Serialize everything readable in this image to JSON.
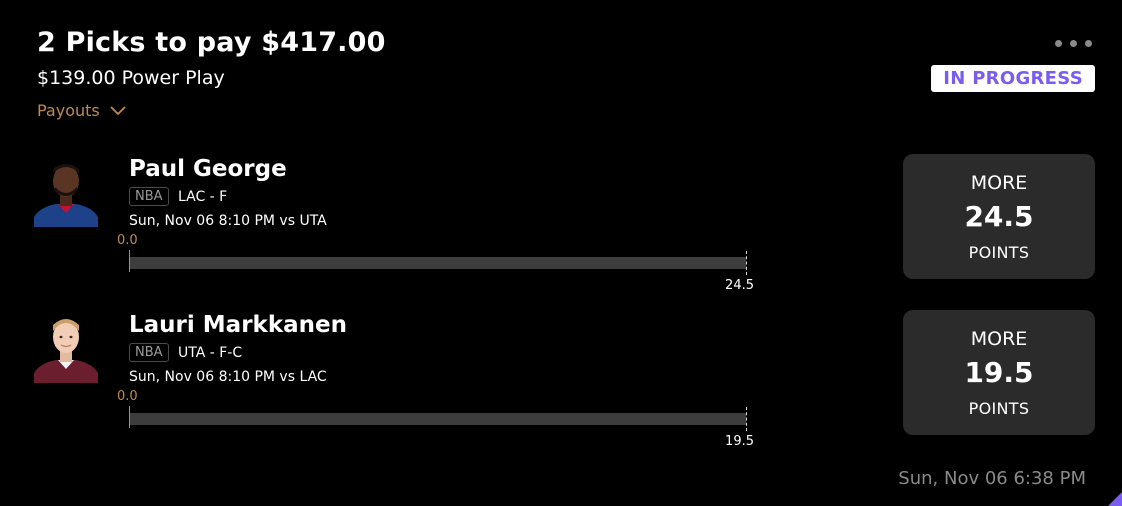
{
  "colors": {
    "background": "#000000",
    "accent_purple": "#7b5cf0",
    "muted_orange": "#c08a4e",
    "muted_text": "#8a8a8a",
    "card_bg": "#2b2b2b",
    "bar_track": "#3d3d3d"
  },
  "header": {
    "title": "2 Picks to pay $417.00",
    "subtitle": "$139.00 Power Play",
    "payouts_label": "Payouts",
    "payouts_icon": "chevron-down-icon",
    "menu_icon": "more-horizontal-icon",
    "status_label": "IN PROGRESS"
  },
  "picks": [
    {
      "player_name": "Paul George",
      "league": "NBA",
      "team_position": "LAC - F",
      "game_time": "Sun, Nov 06 8:10 PM  vs UTA",
      "current_value": "0.0",
      "target_value": "24.5",
      "progress": 0,
      "direction": "MORE",
      "line": "24.5",
      "stat": "POINTS",
      "jersey_color": "#1d428a"
    },
    {
      "player_name": "Lauri Markkanen",
      "league": "NBA",
      "team_position": "UTA - F-C",
      "game_time": "Sun, Nov 06 8:10 PM  vs LAC",
      "current_value": "0.0",
      "target_value": "19.5",
      "progress": 0,
      "direction": "MORE",
      "line": "19.5",
      "stat": "POINTS",
      "jersey_color": "#6b1f2e"
    }
  ],
  "footer": {
    "timestamp": "Sun, Nov 06 6:38 PM"
  }
}
